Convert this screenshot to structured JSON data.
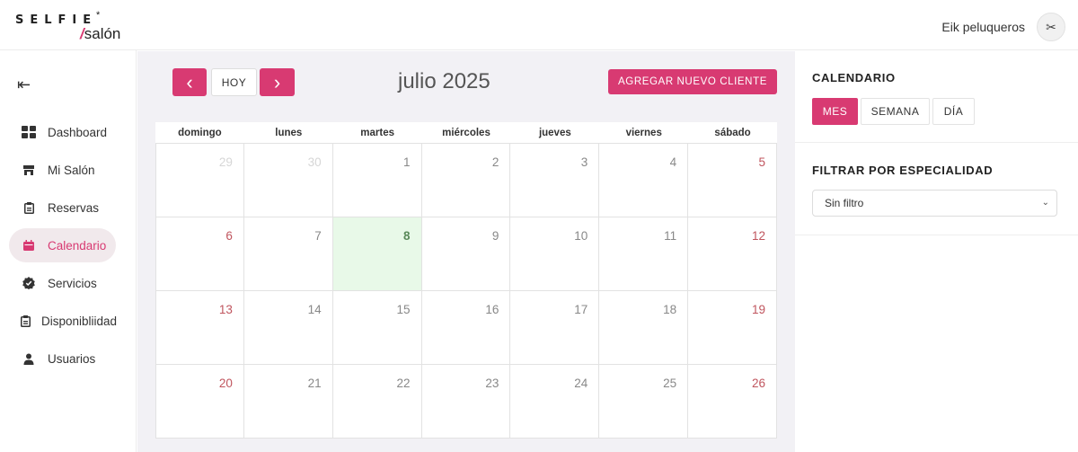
{
  "brand": {
    "top": "SELFIE",
    "star": "*",
    "slash": "/",
    "bottom": "salón"
  },
  "header": {
    "user_name": "Eik peluqueros",
    "avatar_glyph": "✂"
  },
  "sidebar": {
    "collapse_glyph": "⇤",
    "items": [
      {
        "label": "Dashboard",
        "icon": "dashboard-grid-icon"
      },
      {
        "label": "Mi Salón",
        "icon": "store-icon",
        "glyph": "▬"
      },
      {
        "label": "Reservas",
        "icon": "clipboard-icon",
        "glyph": "📋"
      },
      {
        "label": "Calendario",
        "icon": "calendar-icon",
        "glyph": "▬"
      },
      {
        "label": "Servicios",
        "icon": "verified-badge-icon",
        "glyph": "✔"
      },
      {
        "label": "Disponibliidad",
        "icon": "clipboard-icon",
        "glyph": "📋"
      },
      {
        "label": "Usuarios",
        "icon": "user-icon",
        "glyph": "👤"
      }
    ]
  },
  "toolbar": {
    "prev_glyph": "‹",
    "today_label": "HOY",
    "next_glyph": "›",
    "month_title": "julio 2025",
    "add_label": "AGREGAR NUEVO CLIENTE"
  },
  "calendar": {
    "weekdays": [
      "domingo",
      "lunes",
      "martes",
      "miércoles",
      "jueves",
      "viernes",
      "sábado"
    ],
    "weeks": [
      [
        {
          "d": "29",
          "other": true,
          "weekend": true
        },
        {
          "d": "30",
          "other": true
        },
        {
          "d": "1"
        },
        {
          "d": "2"
        },
        {
          "d": "3"
        },
        {
          "d": "4"
        },
        {
          "d": "5",
          "weekend": true
        }
      ],
      [
        {
          "d": "6",
          "weekend": true
        },
        {
          "d": "7"
        },
        {
          "d": "8",
          "today": true
        },
        {
          "d": "9"
        },
        {
          "d": "10"
        },
        {
          "d": "11"
        },
        {
          "d": "12",
          "weekend": true
        }
      ],
      [
        {
          "d": "13",
          "weekend": true
        },
        {
          "d": "14"
        },
        {
          "d": "15"
        },
        {
          "d": "16"
        },
        {
          "d": "17"
        },
        {
          "d": "18"
        },
        {
          "d": "19",
          "weekend": true
        }
      ],
      [
        {
          "d": "20",
          "weekend": true
        },
        {
          "d": "21"
        },
        {
          "d": "22"
        },
        {
          "d": "23"
        },
        {
          "d": "24"
        },
        {
          "d": "25"
        },
        {
          "d": "26",
          "weekend": true
        }
      ]
    ]
  },
  "panel": {
    "calendar_title": "CALENDARIO",
    "views": [
      "MES",
      "SEMANA",
      "DÍA"
    ],
    "active_view": "MES",
    "filter_title": "FILTRAR POR ESPECIALIDAD",
    "filter_value": "Sin filtro",
    "caret_glyph": "⌄"
  },
  "colors": {
    "accent": "#d83a72",
    "today_bg": "#e8f9e8",
    "weekend": "#c0555e"
  }
}
